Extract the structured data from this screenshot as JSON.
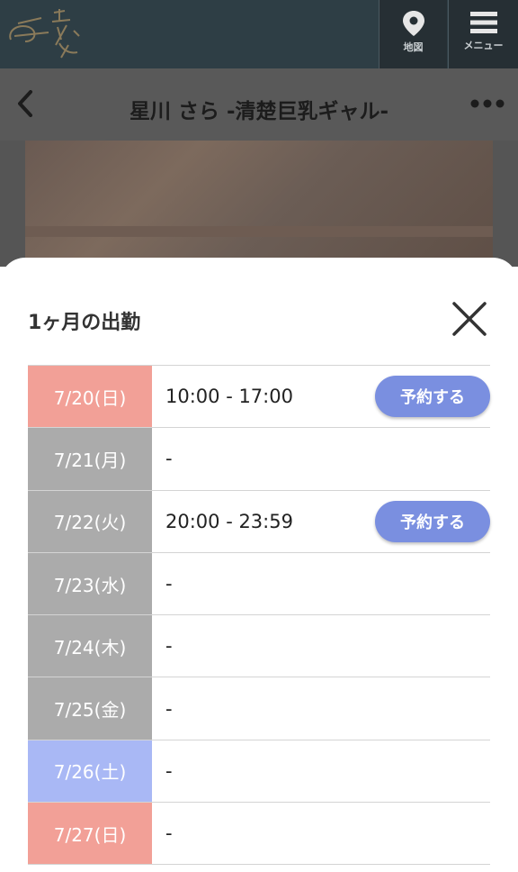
{
  "header": {
    "map_label": "地図",
    "menu_label": "メニュー"
  },
  "titlebar": {
    "title": "星川 さら -清楚巨乳ギャル-"
  },
  "modal": {
    "title": "1ヶ月の出勤",
    "reserve_label": "予約する",
    "rows": [
      {
        "date": "7/20(日)",
        "time": "10:00 - 17:00",
        "day_type": "sun"
      },
      {
        "date": "7/21(月)",
        "time": "-",
        "day_type": "weekday"
      },
      {
        "date": "7/22(火)",
        "time": "20:00 - 23:59",
        "day_type": "weekday"
      },
      {
        "date": "7/23(水)",
        "time": "-",
        "day_type": "weekday"
      },
      {
        "date": "7/24(木)",
        "time": "-",
        "day_type": "weekday"
      },
      {
        "date": "7/25(金)",
        "time": "-",
        "day_type": "weekday"
      },
      {
        "date": "7/26(土)",
        "time": "-",
        "day_type": "sat"
      },
      {
        "date": "7/27(日)",
        "time": "-",
        "day_type": "sun"
      }
    ]
  },
  "colors": {
    "sunday": "#f2a097",
    "weekday": "#ababab",
    "saturday": "#a9b8f5",
    "accent": "#7a8fe0"
  },
  "icons": [
    "logo",
    "map-pin-icon",
    "hamburger-icon",
    "back-arrow-icon",
    "more-icon",
    "close-icon"
  ]
}
